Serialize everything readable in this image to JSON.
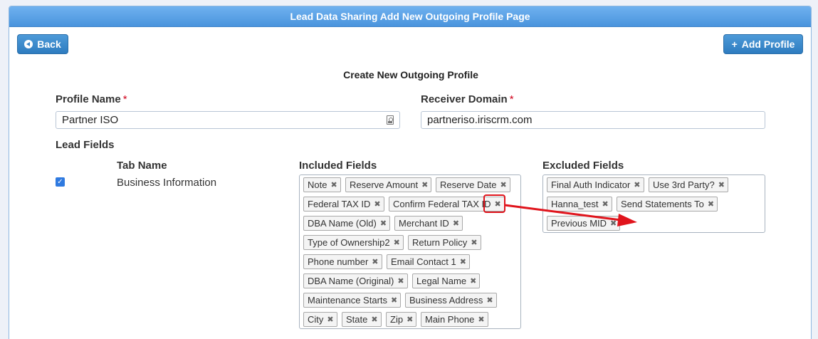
{
  "header": {
    "title": "Lead Data Sharing Add New Outgoing Profile Page"
  },
  "toolbar": {
    "back_label": "Back",
    "add_label": "Add Profile",
    "add_icon": "+"
  },
  "form": {
    "title": "Create New Outgoing Profile",
    "profile_name_label": "Profile Name",
    "profile_name_value": "Partner ISO",
    "receiver_domain_label": "Receiver Domain",
    "receiver_domain_value": "partneriso.iriscrm.com",
    "required_mark": "*",
    "lead_fields_label": "Lead Fields",
    "tab_name_header": "Tab Name",
    "included_header": "Included Fields",
    "excluded_header": "Excluded Fields",
    "row": {
      "checked": true,
      "tab_name": "Business Information"
    },
    "included_fields": [
      "Note",
      "Reserve Amount",
      "Reserve Date",
      "Federal TAX ID",
      "Confirm Federal TAX ID",
      "DBA Name (Old)",
      "Merchant ID",
      "Type of Ownership2",
      "Return Policy",
      "Phone number",
      "Email Contact 1",
      "DBA Name (Original)",
      "Legal Name",
      "Maintenance Starts",
      "Business Address",
      "City",
      "State",
      "Zip",
      "Main Phone"
    ],
    "excluded_fields": [
      "Final Auth Indicator",
      "Use 3rd Party?",
      "Hanna_test",
      "Send Statements To",
      "Previous MID"
    ],
    "remove_glyph": "✖"
  },
  "annotation": {
    "color": "#e0141c"
  }
}
